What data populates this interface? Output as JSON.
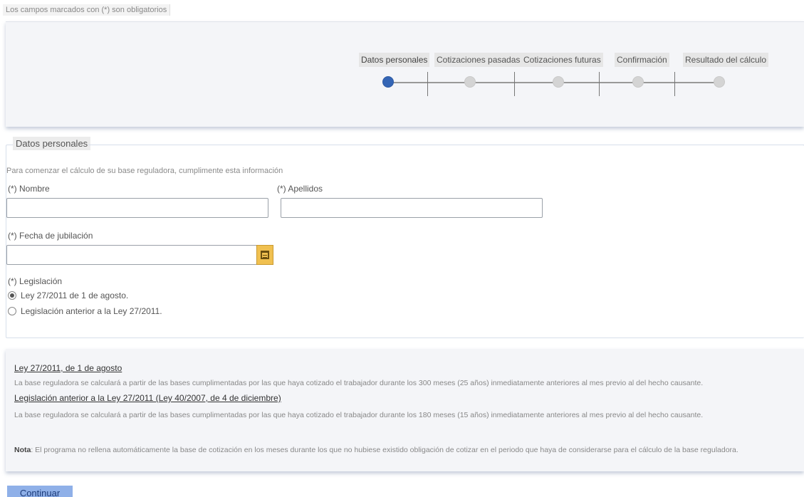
{
  "notice": "Los campos marcados con (*) son obligatorios",
  "steps": [
    {
      "label": "Datos personales",
      "active": true
    },
    {
      "label": "Cotizaciones pasadas",
      "active": false
    },
    {
      "label": "Cotizaciones futuras",
      "active": false
    },
    {
      "label": "Confirmación",
      "active": false
    },
    {
      "label": "Resultado del cálculo",
      "active": false
    }
  ],
  "form": {
    "legend": "Datos personales",
    "intro": "Para comenzar el cálculo de su base reguladora, cumplimente esta información",
    "nombre_label": "(*) Nombre",
    "nombre_value": "",
    "apellidos_label": "(*) Apellidos",
    "apellidos_value": "",
    "fecha_label": "(*) Fecha de jubilación",
    "fecha_value": "",
    "legislacion_label": "(*) Legislación",
    "options": [
      {
        "label": "Ley 27/2011 de 1 de agosto.",
        "checked": true
      },
      {
        "label": "Legislación anterior a la Ley 27/2011.",
        "checked": false
      }
    ]
  },
  "info": {
    "link1": "Ley 27/2011, de 1 de agosto",
    "text1": "La base reguladora se calculará a partir de las bases cumplimentadas por las que haya cotizado el trabajador durante los 300 meses (25 años) inmediatamente anteriores al mes previo al del hecho causante.",
    "link2": "Legislación anterior a la Ley 27/2011 (Ley 40/2007, de 4 de diciembre)",
    "text2": "La base reguladora se calculará a partir de las bases cumplimentadas por las que haya cotizado el trabajador durante los 180 meses (15 años) inmediatamente anteriores al mes previo al del hecho causante.",
    "note_label": "Nota",
    "note_text": ": El programa no rellena automáticamente la base de cotización en los meses durante los que no hubiese existido obligación de cotizar en el periodo que haya de considerarse para el cálculo de la base reguladora."
  },
  "continue_label": "Continuar",
  "colors": {
    "active_step": "#3465b5",
    "button": "#8fb0e8",
    "calendar_button": "#f0c050"
  },
  "icons": [
    "calendar-icon"
  ]
}
